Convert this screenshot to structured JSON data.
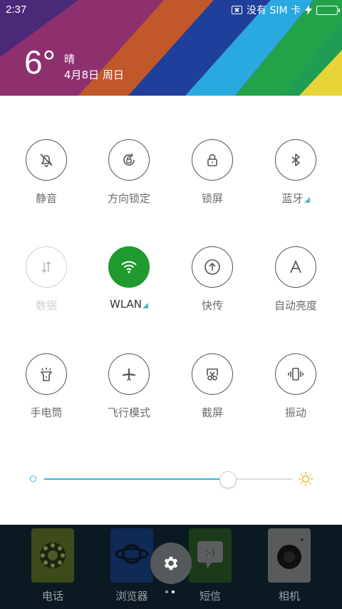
{
  "status_bar": {
    "time": "2:37",
    "carrier": "没有 SIM 卡",
    "battery_level": 1.0,
    "charging": true
  },
  "weather": {
    "temperature": "6°",
    "condition": "晴",
    "date": "4月8日 周日"
  },
  "toggles": [
    {
      "label": "静音",
      "icon": "bell-off-icon",
      "state": "off",
      "has_menu": false
    },
    {
      "label": "方向锁定",
      "icon": "rotation-lock-icon",
      "state": "off",
      "has_menu": false
    },
    {
      "label": "锁屏",
      "icon": "lock-icon",
      "state": "off",
      "has_menu": false
    },
    {
      "label": "蓝牙",
      "icon": "bluetooth-icon",
      "state": "off",
      "has_menu": true
    },
    {
      "label": "数据",
      "icon": "data-transfer-icon",
      "state": "disabled",
      "has_menu": false
    },
    {
      "label": "WLAN",
      "icon": "wifi-icon",
      "state": "on",
      "has_menu": true
    },
    {
      "label": "快传",
      "icon": "upload-icon",
      "state": "off",
      "has_menu": false
    },
    {
      "label": "自动亮度",
      "icon": "auto-brightness-icon",
      "state": "off",
      "has_menu": false
    },
    {
      "label": "手电筒",
      "icon": "flashlight-icon",
      "state": "off",
      "has_menu": false
    },
    {
      "label": "飞行模式",
      "icon": "airplane-icon",
      "state": "off",
      "has_menu": false
    },
    {
      "label": "截屏",
      "icon": "screenshot-icon",
      "state": "off",
      "has_menu": false
    },
    {
      "label": "振动",
      "icon": "vibrate-icon",
      "state": "off",
      "has_menu": false
    }
  ],
  "brightness": {
    "level": 0.74,
    "accent": "#33b4d9",
    "sun_color": "#f0b429"
  },
  "dock": {
    "apps": [
      {
        "label": "电话",
        "icon": "phone-dial-icon"
      },
      {
        "label": "浏览器",
        "icon": "browser-planet-icon"
      },
      {
        "label": "短信",
        "icon": "message-icon"
      },
      {
        "label": "相机",
        "icon": "camera-icon"
      }
    ],
    "settings_icon": "gear-icon",
    "pages": 2,
    "current_page": 1
  },
  "colors": {
    "active_toggle": "#1e9a2e",
    "corner_marker": "#52b7c6"
  }
}
